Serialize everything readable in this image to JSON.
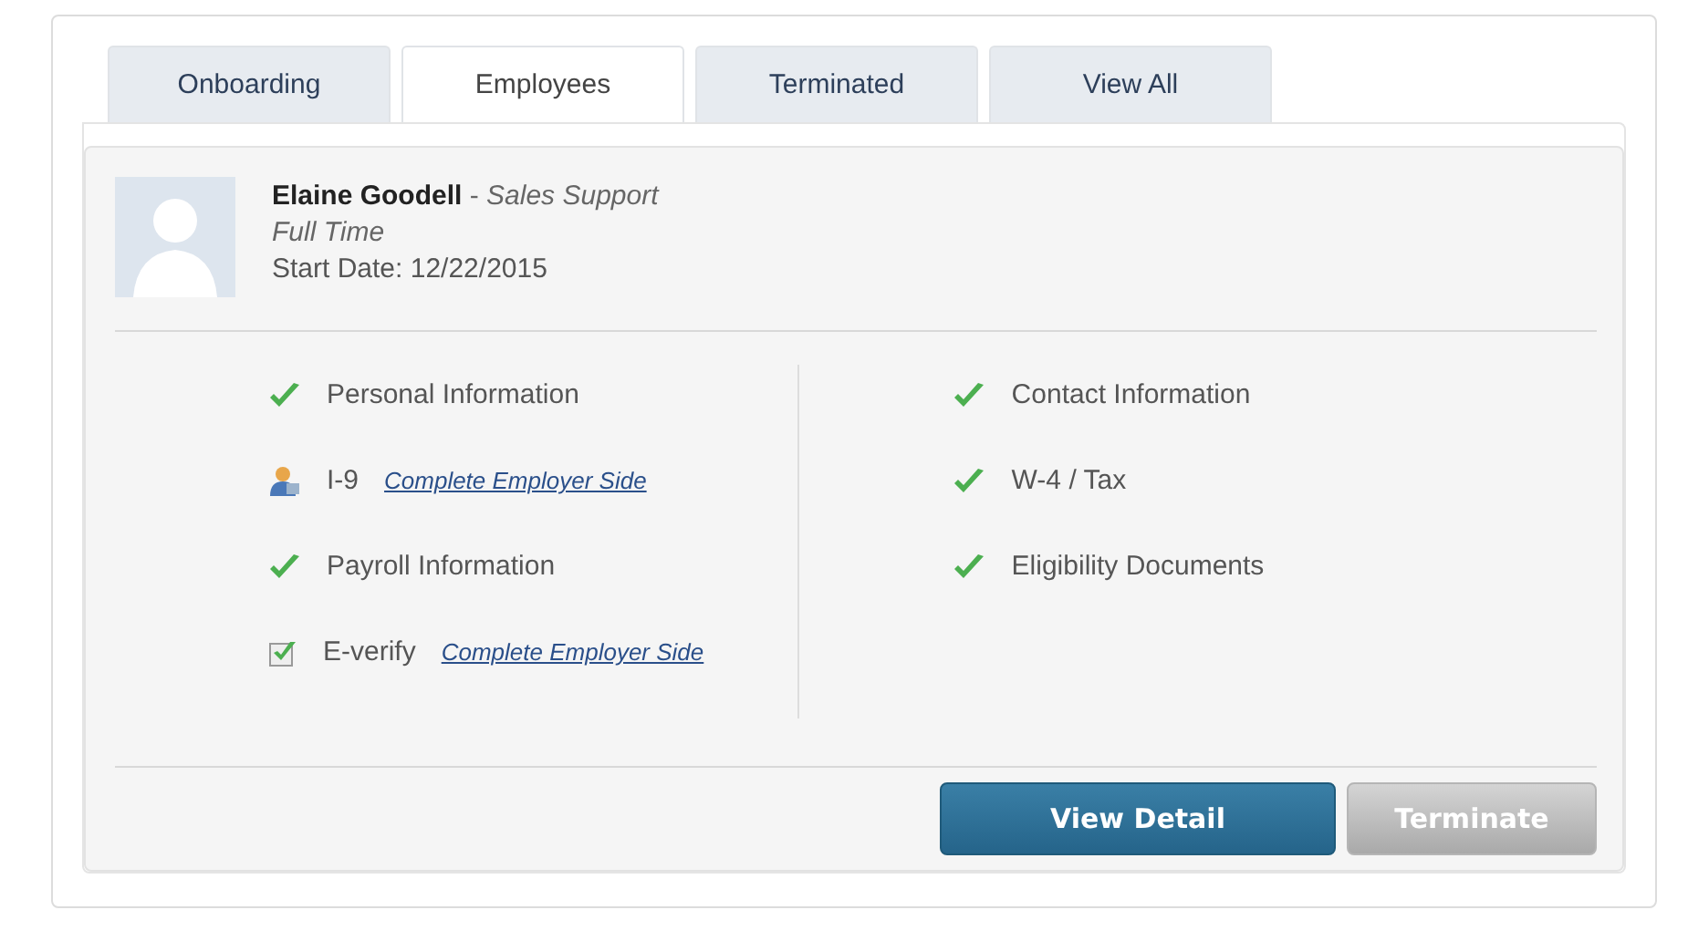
{
  "tabs": [
    {
      "label": "Onboarding",
      "selected": false
    },
    {
      "label": "Employees",
      "selected": true
    },
    {
      "label": "Terminated",
      "selected": false
    },
    {
      "label": "View All",
      "selected": false
    }
  ],
  "employee": {
    "name": "Elaine Goodell",
    "separator": " - ",
    "role": "Sales Support",
    "type": "Full Time",
    "start_date": "Start Date: 12/22/2015"
  },
  "tasks_left": [
    {
      "kind": "check",
      "label": "Personal Information"
    },
    {
      "kind": "person",
      "label": "I-9",
      "link": "Complete Employer Side"
    },
    {
      "kind": "check",
      "label": "Payroll Information"
    },
    {
      "kind": "checkbox",
      "label": "E-verify",
      "link": "Complete Employer Side"
    }
  ],
  "tasks_right": [
    {
      "kind": "check",
      "label": "Contact Information"
    },
    {
      "kind": "check",
      "label": "W-4 / Tax"
    },
    {
      "kind": "check",
      "label": "Eligibility Documents"
    }
  ],
  "buttons": [
    {
      "label": "View Detail",
      "disabled": false
    },
    {
      "label": "Terminate",
      "disabled": true
    }
  ]
}
